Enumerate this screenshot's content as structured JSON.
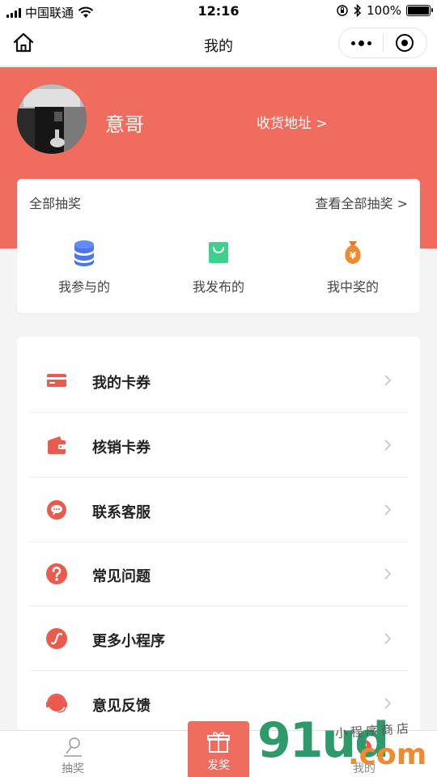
{
  "status_bar": {
    "carrier": "中国联通",
    "time": "12:16",
    "battery_percent": "100%",
    "battery_level": 1.0,
    "icons": [
      "signal-icon",
      "wifi-icon",
      "orientation-lock-icon",
      "bluetooth-icon",
      "battery-icon"
    ]
  },
  "nav": {
    "title": "我的",
    "icons": [
      "home-icon",
      "more-icon",
      "close-mini-program-icon"
    ]
  },
  "profile": {
    "name": "意哥",
    "address_link": "收货地址 >"
  },
  "lottery": {
    "title": "全部抽奖",
    "view_all": "查看全部抽奖 >",
    "items": [
      {
        "label": "我参与的",
        "icon": "database-stack-icon",
        "color": "#4a76e8"
      },
      {
        "label": "我发布的",
        "icon": "shopping-bag-icon",
        "color": "#3fcf8e"
      },
      {
        "label": "我中奖的",
        "icon": "money-bag-icon",
        "color": "#f08a2e"
      }
    ]
  },
  "menu": {
    "items": [
      {
        "label": "我的卡券",
        "icon": "card-icon"
      },
      {
        "label": "核销卡券",
        "icon": "wallet-icon"
      },
      {
        "label": "联系客服",
        "icon": "chat-bubble-icon"
      },
      {
        "label": "常见问题",
        "icon": "question-icon"
      },
      {
        "label": "更多小程序",
        "icon": "link-icon"
      },
      {
        "label": "意见反馈",
        "icon": "headset-icon"
      }
    ]
  },
  "tab_bar": {
    "tabs": [
      {
        "label": "抽奖",
        "icon": "lottery-icon"
      },
      {
        "label": "发奖",
        "icon": "gift-icon"
      },
      {
        "label": "我的",
        "icon": "user-icon"
      }
    ]
  },
  "watermark": {
    "main": "91ud",
    "com": ".com",
    "sub": "小程序商店"
  },
  "colors": {
    "accent": "#ef6c5f",
    "background": "#f4f4f4",
    "card": "#ffffff"
  }
}
